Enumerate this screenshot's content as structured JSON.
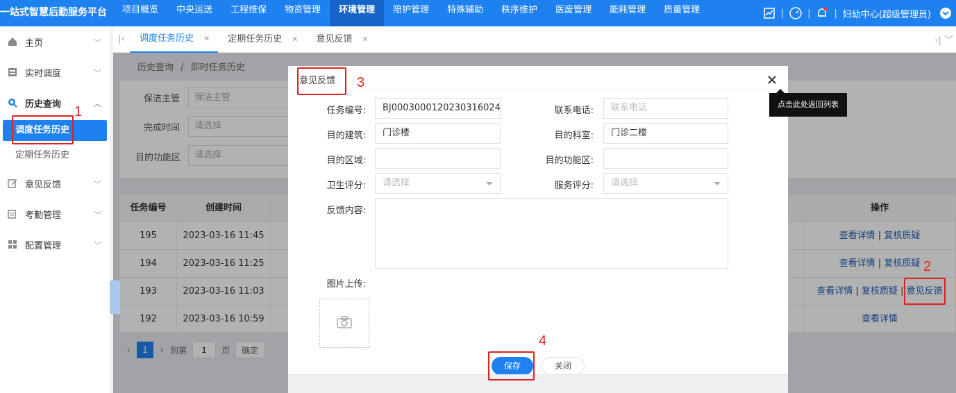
{
  "app": {
    "title": "一站式智慧后勤服务平台"
  },
  "topnav": [
    "项目概览",
    "中央运送",
    "工程维保",
    "物资管理",
    "环境管理",
    "陪护管理",
    "特殊辅助",
    "秩序维护",
    "医废管理",
    "能耗管理",
    "质量管理"
  ],
  "topnav_active": "环境管理",
  "user": {
    "name": "妇幼中心(超级管理员)"
  },
  "sidebar": {
    "items": [
      {
        "label": "主页"
      },
      {
        "label": "实时调度"
      },
      {
        "label": "历史查询"
      },
      {
        "label": "意见反馈"
      },
      {
        "label": "考勤管理"
      },
      {
        "label": "配置管理"
      }
    ],
    "sub": [
      {
        "label": "调度任务历史"
      },
      {
        "label": "定期任务历史"
      }
    ]
  },
  "tabs": [
    {
      "label": "调度任务历史"
    },
    {
      "label": "定期任务历史"
    },
    {
      "label": "意见反馈"
    }
  ],
  "breadcrumb": {
    "parent": "历史查询",
    "sep": "/",
    "current": "即时任务历史"
  },
  "filters": {
    "cleaner_label": "保洁主管",
    "cleaner_placeholder": "保洁主管",
    "time_label": "完成时间",
    "time_placeholder": "请选择",
    "area_label": "目的功能区",
    "area_placeholder": "请选择"
  },
  "table": {
    "headers": [
      "任务编号",
      "创建时间",
      "",
      "操作"
    ],
    "rows": [
      {
        "id": "195",
        "time": "2023-03-16 11:45",
        "ops": [
          "查看详情",
          "复核质疑"
        ]
      },
      {
        "id": "194",
        "time": "2023-03-16 11:25",
        "ops": [
          "查看详情",
          "复核质疑"
        ]
      },
      {
        "id": "193",
        "time": "2023-03-16 11:03",
        "ops": [
          "查看详情",
          "复核质疑",
          "意见反馈"
        ]
      },
      {
        "id": "192",
        "time": "2023-03-16 10:59",
        "ops": [
          "查看详情"
        ]
      }
    ]
  },
  "pager": {
    "page": "1",
    "goto": "到第",
    "unit": "页",
    "confirm": "确定"
  },
  "modal": {
    "title": "意见反馈",
    "task_no_label": "任务编号:",
    "task_no": "BJ0003000120230316024",
    "phone_label": "联系电话:",
    "phone_placeholder": "联系电话",
    "building_label": "目的建筑:",
    "building": "门诊楼",
    "dept_label": "目的科室:",
    "dept": "门诊二楼",
    "region_label": "目的区域:",
    "region": "",
    "func_label": "目的功能区:",
    "func": "",
    "hygiene_label": "卫生评分:",
    "hygiene_placeholder": "请选择",
    "service_label": "服务评分:",
    "service_placeholder": "请选择",
    "content_label": "反馈内容:",
    "image_label": "图片上传:",
    "save": "保存",
    "close": "关闭"
  },
  "tooltip": "点击此处返回列表",
  "annotations": [
    "1",
    "2",
    "3",
    "4"
  ]
}
